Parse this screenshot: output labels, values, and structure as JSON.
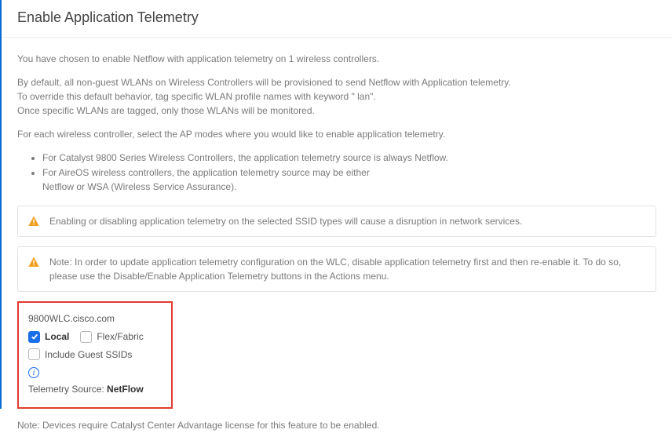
{
  "title": "Enable Application Telemetry",
  "intro": {
    "line1": "You have chosen to enable Netflow with application telemetry on 1 wireless controllers.",
    "p2a": "By default, all non-guest WLANs on Wireless Controllers will be provisioned to send Netflow with Application telemetry.",
    "p2b": "To override this default behavior, tag specific WLAN profile names with keyword \" lan\".",
    "p2c": "Once specific WLANs are tagged, only those WLANs will be monitored.",
    "line3": "For each wireless controller, select the AP modes where you would like to enable application telemetry."
  },
  "bullets": {
    "b1": "For Catalyst 9800 Series Wireless Controllers, the application telemetry source is always Netflow.",
    "b2a": "For AireOS wireless controllers, the application telemetry source may be either",
    "b2b": "Netflow or WSA (Wireless Service Assurance)."
  },
  "alerts": {
    "a1": "Enabling or disabling application telemetry on the selected SSID types will cause a disruption in network services.",
    "a2": "Note: In order to update application telemetry configuration on the WLC, disable application telemetry first and then re-enable it. To do so, please use the Disable/Enable Application Telemetry buttons in the Actions menu."
  },
  "controller": {
    "name": "9800WLC.cisco.com",
    "local_label": "Local",
    "flex_label": "Flex/Fabric",
    "include_guest_label": "Include Guest SSIDs",
    "source_prefix": "Telemetry Source: ",
    "source_value": "NetFlow"
  },
  "footnote": "Note: Devices require Catalyst Center Advantage license for this feature to be enabled."
}
